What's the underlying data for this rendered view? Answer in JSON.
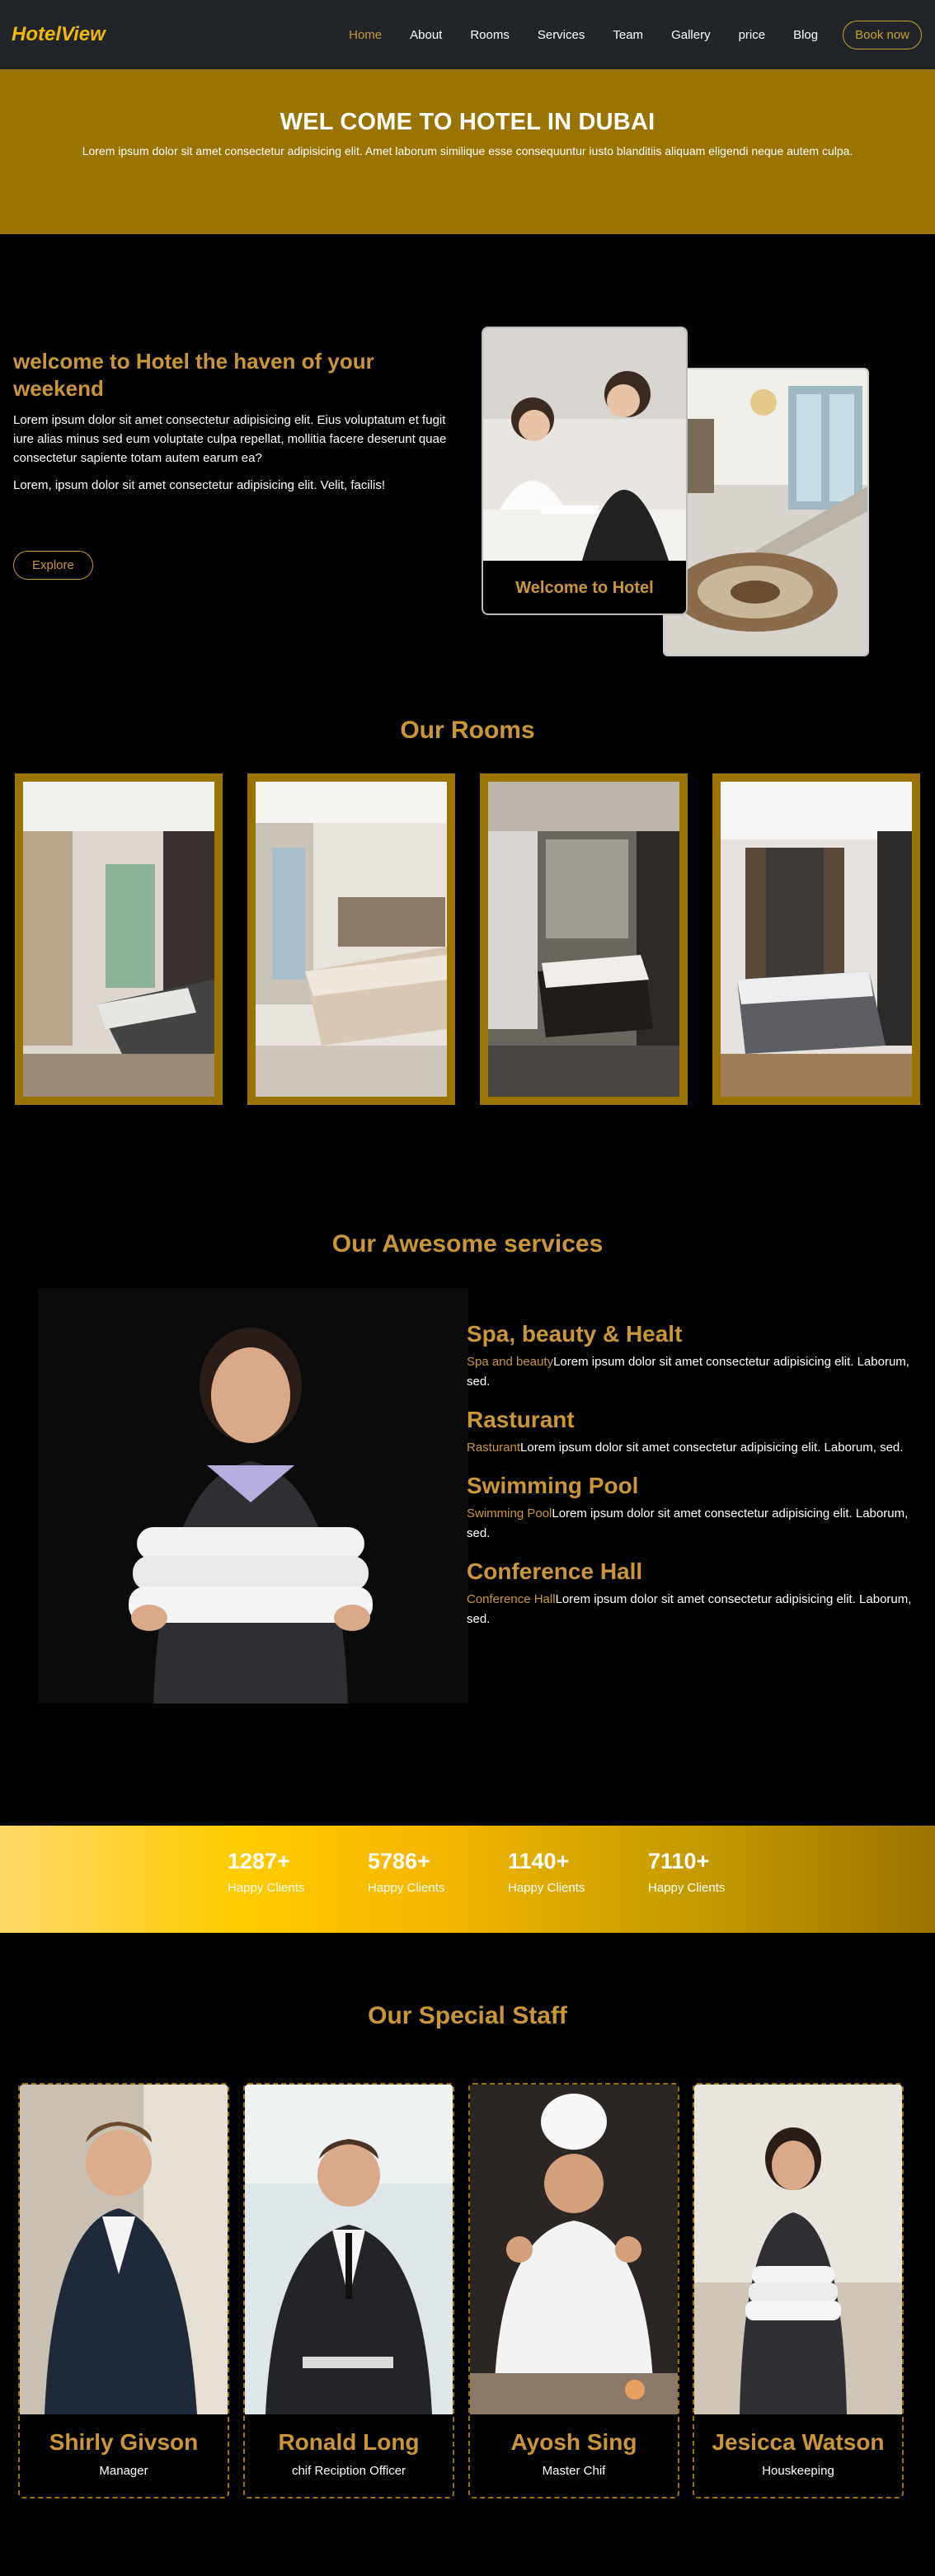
{
  "nav": {
    "brand": "HotelView",
    "items": [
      "Home",
      "About",
      "Rooms",
      "Services",
      "Team",
      "Gallery",
      "price",
      "Blog"
    ],
    "book": "Book now"
  },
  "hero": {
    "title": "WEL COME TO HOTEL IN DUBAI",
    "subtitle": "Lorem ipsum dolor sit amet consectetur adipisicing elit. Amet laborum similique esse consequuntur iusto blanditiis aliquam eligendi neque autem culpa."
  },
  "welcome": {
    "heading": "welcome to Hotel the haven of your weekend",
    "p1": "Lorem ipsum dolor sit amet consectetur adipisicing elit. Eius voluptatum et fugit iure alias minus sed eum voluptate culpa repellat, mollitia facere deserunt quae consectetur sapiente totam autem earum ea?",
    "p2": "Lorem, ipsum dolor sit amet consectetur adipisicing elit. Velit, facilis!",
    "button": "Explore",
    "card_caption": "Welcome to Hotel"
  },
  "rooms": {
    "title": "Our Rooms"
  },
  "services": {
    "title": "Our Awesome services",
    "items": [
      {
        "title": "Spa, beauty & Healt",
        "tag": "Spa and beauty",
        "text": "Lorem ipsum dolor sit amet consectetur adipisicing elit. Laborum, sed."
      },
      {
        "title": "Rasturant",
        "tag": "Rasturant",
        "text": "Lorem ipsum dolor sit amet consectetur adipisicing elit. Laborum, sed."
      },
      {
        "title": "Swimming Pool",
        "tag": "Swimming Pool",
        "text": "Lorem ipsum dolor sit amet consectetur adipisicing elit. Laborum, sed."
      },
      {
        "title": "Conference Hall",
        "tag": "Conference Hall",
        "text": "Lorem ipsum dolor sit amet consectetur adipisicing elit. Laborum, sed."
      }
    ]
  },
  "stats": [
    {
      "num": "1287+",
      "label": "Happy Clients"
    },
    {
      "num": "5786+",
      "label": "Happy Clients"
    },
    {
      "num": "1140+",
      "label": "Happy Clients"
    },
    {
      "num": "7110+",
      "label": "Happy Clients"
    }
  ],
  "staff": {
    "title": "Our Special Staff",
    "members": [
      {
        "name": "Shirly Givson",
        "role": "Manager"
      },
      {
        "name": "Ronald Long",
        "role": "chif Reciption Officer"
      },
      {
        "name": "Ayosh Sing",
        "role": "Master Chif"
      },
      {
        "name": "Jesicca Watson",
        "role": "Houskeeping"
      }
    ]
  },
  "colors": {
    "gold": "#c9973a",
    "brand": "#f2b90d",
    "hero_bg": "#9a7400",
    "nav_bg": "#212529"
  }
}
